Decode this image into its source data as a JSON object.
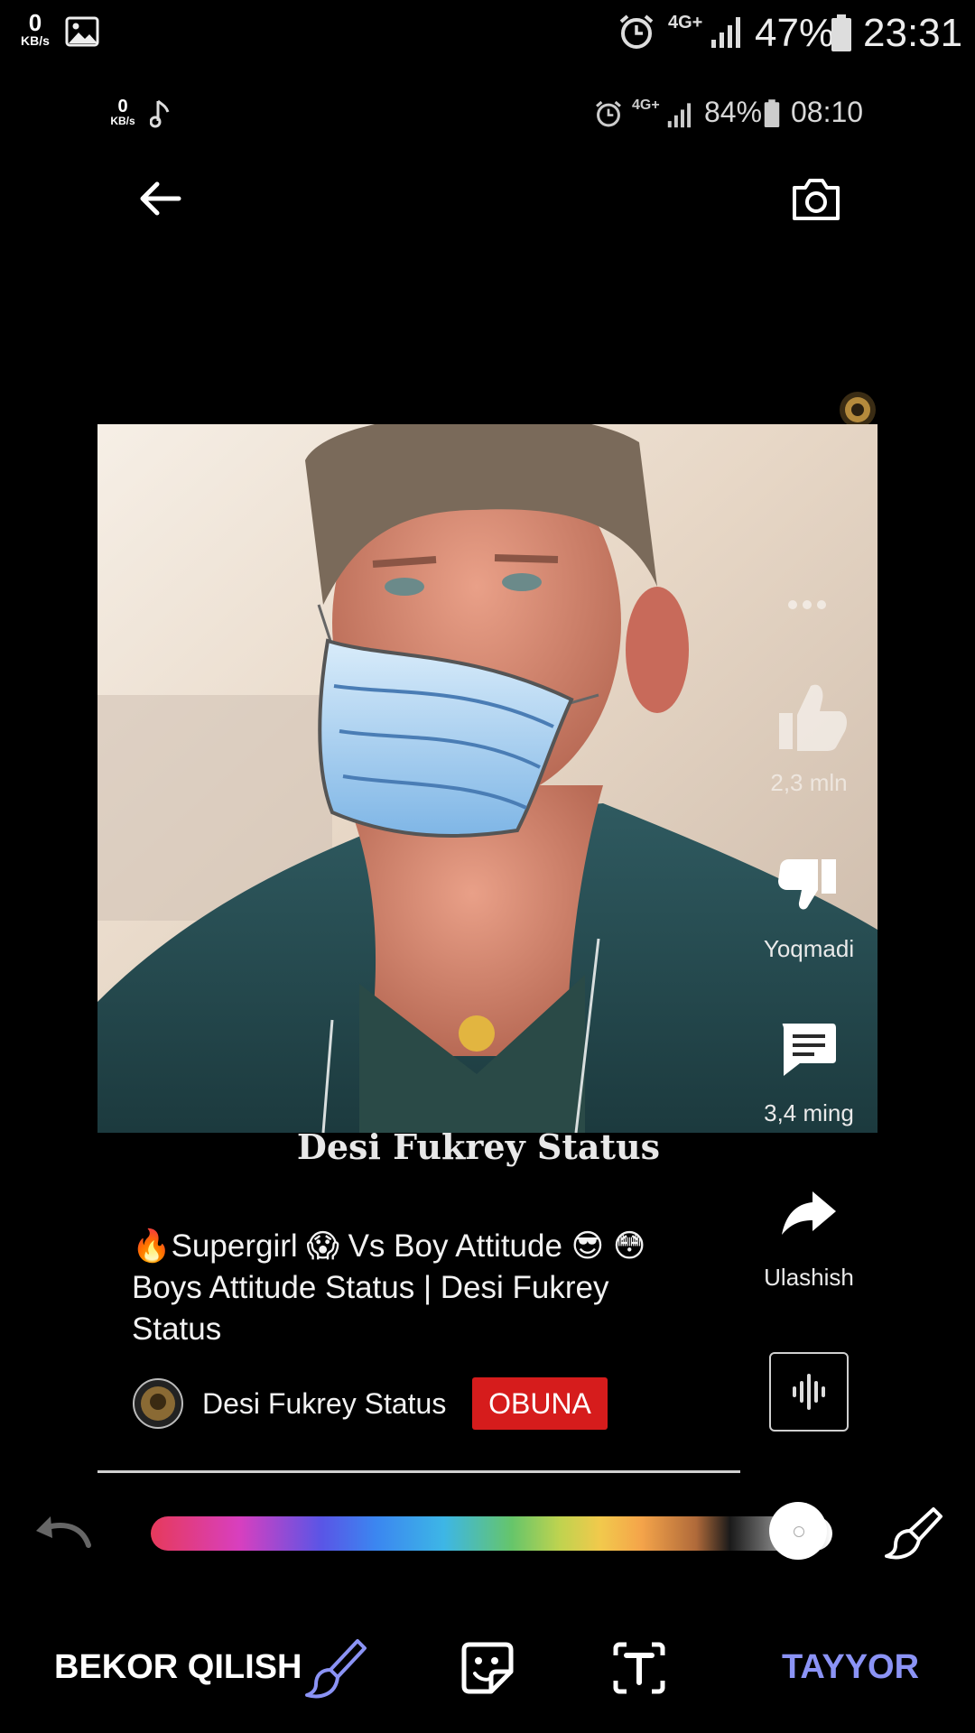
{
  "outer_status": {
    "speed_value": "0",
    "speed_unit": "KB/s",
    "network": "4G+",
    "battery": "47%",
    "time": "23:31"
  },
  "inner_status": {
    "speed_value": "0",
    "speed_unit": "KB/s",
    "network": "4G+",
    "battery": "84%",
    "time": "08:10"
  },
  "video": {
    "overlay_caption": "Desi Fukrey Status",
    "likes": "2,3 mln",
    "dislike_label": "Yoqmadi",
    "comments": "3,4 ming",
    "share_label": "Ulashish",
    "title": "🔥Supergirl 😱 Vs Boy Attitude 😎 😳Boys Attitude Status | Desi Fukrey Status",
    "channel_name": "Desi Fukrey Status",
    "subscribe_label": "OBUNA"
  },
  "editor": {
    "cancel_label": "BEKOR QILISH",
    "done_label": "TAYYOR",
    "accent_color": "#8b93f5",
    "brush_size_fraction": 0.95
  },
  "icons": [
    "image-icon",
    "alarm-icon",
    "signal-icon",
    "battery-icon",
    "music-note-icon",
    "back-arrow-icon",
    "camera-icon",
    "more-icon",
    "like-icon",
    "dislike-icon",
    "comment-icon",
    "share-icon",
    "audio-wave-icon",
    "undo-icon",
    "brush-tip-icon",
    "brush-icon",
    "sticker-icon",
    "text-icon"
  ]
}
